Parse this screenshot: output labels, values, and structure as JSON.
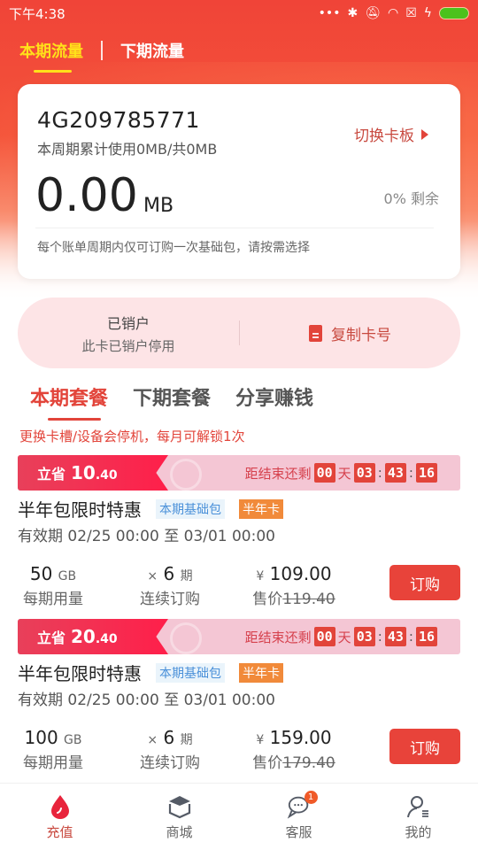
{
  "status_bar": {
    "time": "下午4:38",
    "icons": [
      "more-dots-icon",
      "bluetooth-icon",
      "mute-icon",
      "wifi-icon",
      "sim-x-icon",
      "charging-icon",
      "battery-icon"
    ]
  },
  "header_tabs": [
    {
      "label": "本期流量",
      "active": true
    },
    {
      "label": "下期流量",
      "active": false
    }
  ],
  "info_card": {
    "card_number": "4G209785771",
    "usage_text": "本周期累计使用0MB/共0MB",
    "switch_label": "切换卡板",
    "amount": "0.00",
    "unit": "MB",
    "remaining": "0% 剩余",
    "note": "每个账单周期内仅可订购一次基础包，请按需选择"
  },
  "status_pill": {
    "title": "已销户",
    "subtitle": "此卡已销户停用",
    "copy_label": "复制卡号"
  },
  "package_tabs": [
    {
      "label": "本期套餐",
      "active": true
    },
    {
      "label": "下期套餐",
      "active": false
    },
    {
      "label": "分享赚钱",
      "active": false
    }
  ],
  "package_note": "更换卡槽/设备会停机，每月可解锁1次",
  "offers": [
    {
      "save_label": "立省",
      "save_int": "10",
      "save_dec": ".40",
      "countdown_label": "距结束还剩",
      "days": "00",
      "day_unit": "天",
      "hours": "03",
      "minutes": "43",
      "seconds": "16",
      "title": "半年包限时特惠",
      "tag1": "本期基础包",
      "tag2": "半年卡",
      "validity": "有效期 02/25 00:00 至 03/01 00:00",
      "data_amount": "50",
      "data_unit": "GB",
      "data_label": "每期用量",
      "periods_prefix": "×",
      "periods": "6",
      "periods_unit": "期",
      "periods_label": "连续订购",
      "currency": "¥",
      "price": "109.00",
      "orig_label": "售价",
      "orig_price": "119.40",
      "buy_label": "订购"
    },
    {
      "save_label": "立省",
      "save_int": "20",
      "save_dec": ".40",
      "countdown_label": "距结束还剩",
      "days": "00",
      "day_unit": "天",
      "hours": "03",
      "minutes": "43",
      "seconds": "16",
      "title": "半年包限时特惠",
      "tag1": "本期基础包",
      "tag2": "半年卡",
      "validity": "有效期 02/25 00:00 至 03/01 00:00",
      "data_amount": "100",
      "data_unit": "GB",
      "data_label": "每期用量",
      "periods_prefix": "×",
      "periods": "6",
      "periods_unit": "期",
      "periods_label": "连续订购",
      "currency": "¥",
      "price": "159.00",
      "orig_label": "售价",
      "orig_price": "179.40",
      "buy_label": "订购"
    }
  ],
  "bottom_nav": [
    {
      "label": "充值",
      "icon": "drop-icon",
      "active": true
    },
    {
      "label": "商城",
      "icon": "box-icon",
      "active": false
    },
    {
      "label": "客服",
      "icon": "chat-icon",
      "active": false,
      "badge": "1"
    },
    {
      "label": "我的",
      "icon": "user-icon",
      "active": false
    }
  ],
  "colors": {
    "primary_red": "#e2443a",
    "highlight_yellow": "#ffe11a",
    "pill_bg": "#fde4e6",
    "tag_orange": "#f18a3a",
    "tag_blue": "#4a90d9"
  }
}
